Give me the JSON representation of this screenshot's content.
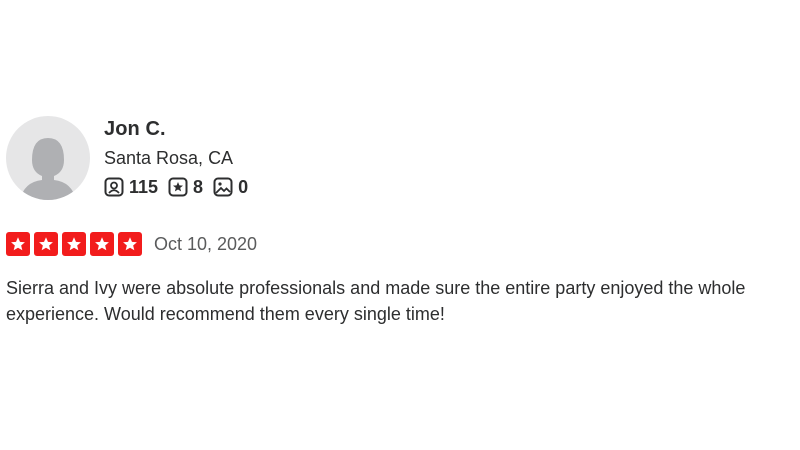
{
  "review": {
    "user": {
      "name": "Jon C.",
      "location": "Santa Rosa, CA",
      "avatar_icon": "default-user-avatar",
      "stats": [
        {
          "icon": "friends-icon",
          "value": "115"
        },
        {
          "icon": "reviews-star-icon",
          "value": "8"
        },
        {
          "icon": "photos-icon",
          "value": "0"
        }
      ]
    },
    "rating": {
      "stars": 5,
      "max_stars": 5,
      "star_color": "#f21c1c"
    },
    "date": "Oct 10, 2020",
    "text": "Sierra and Ivy were absolute professionals and made sure the entire party enjoyed the whole experience. Would recommend them every single time!"
  }
}
